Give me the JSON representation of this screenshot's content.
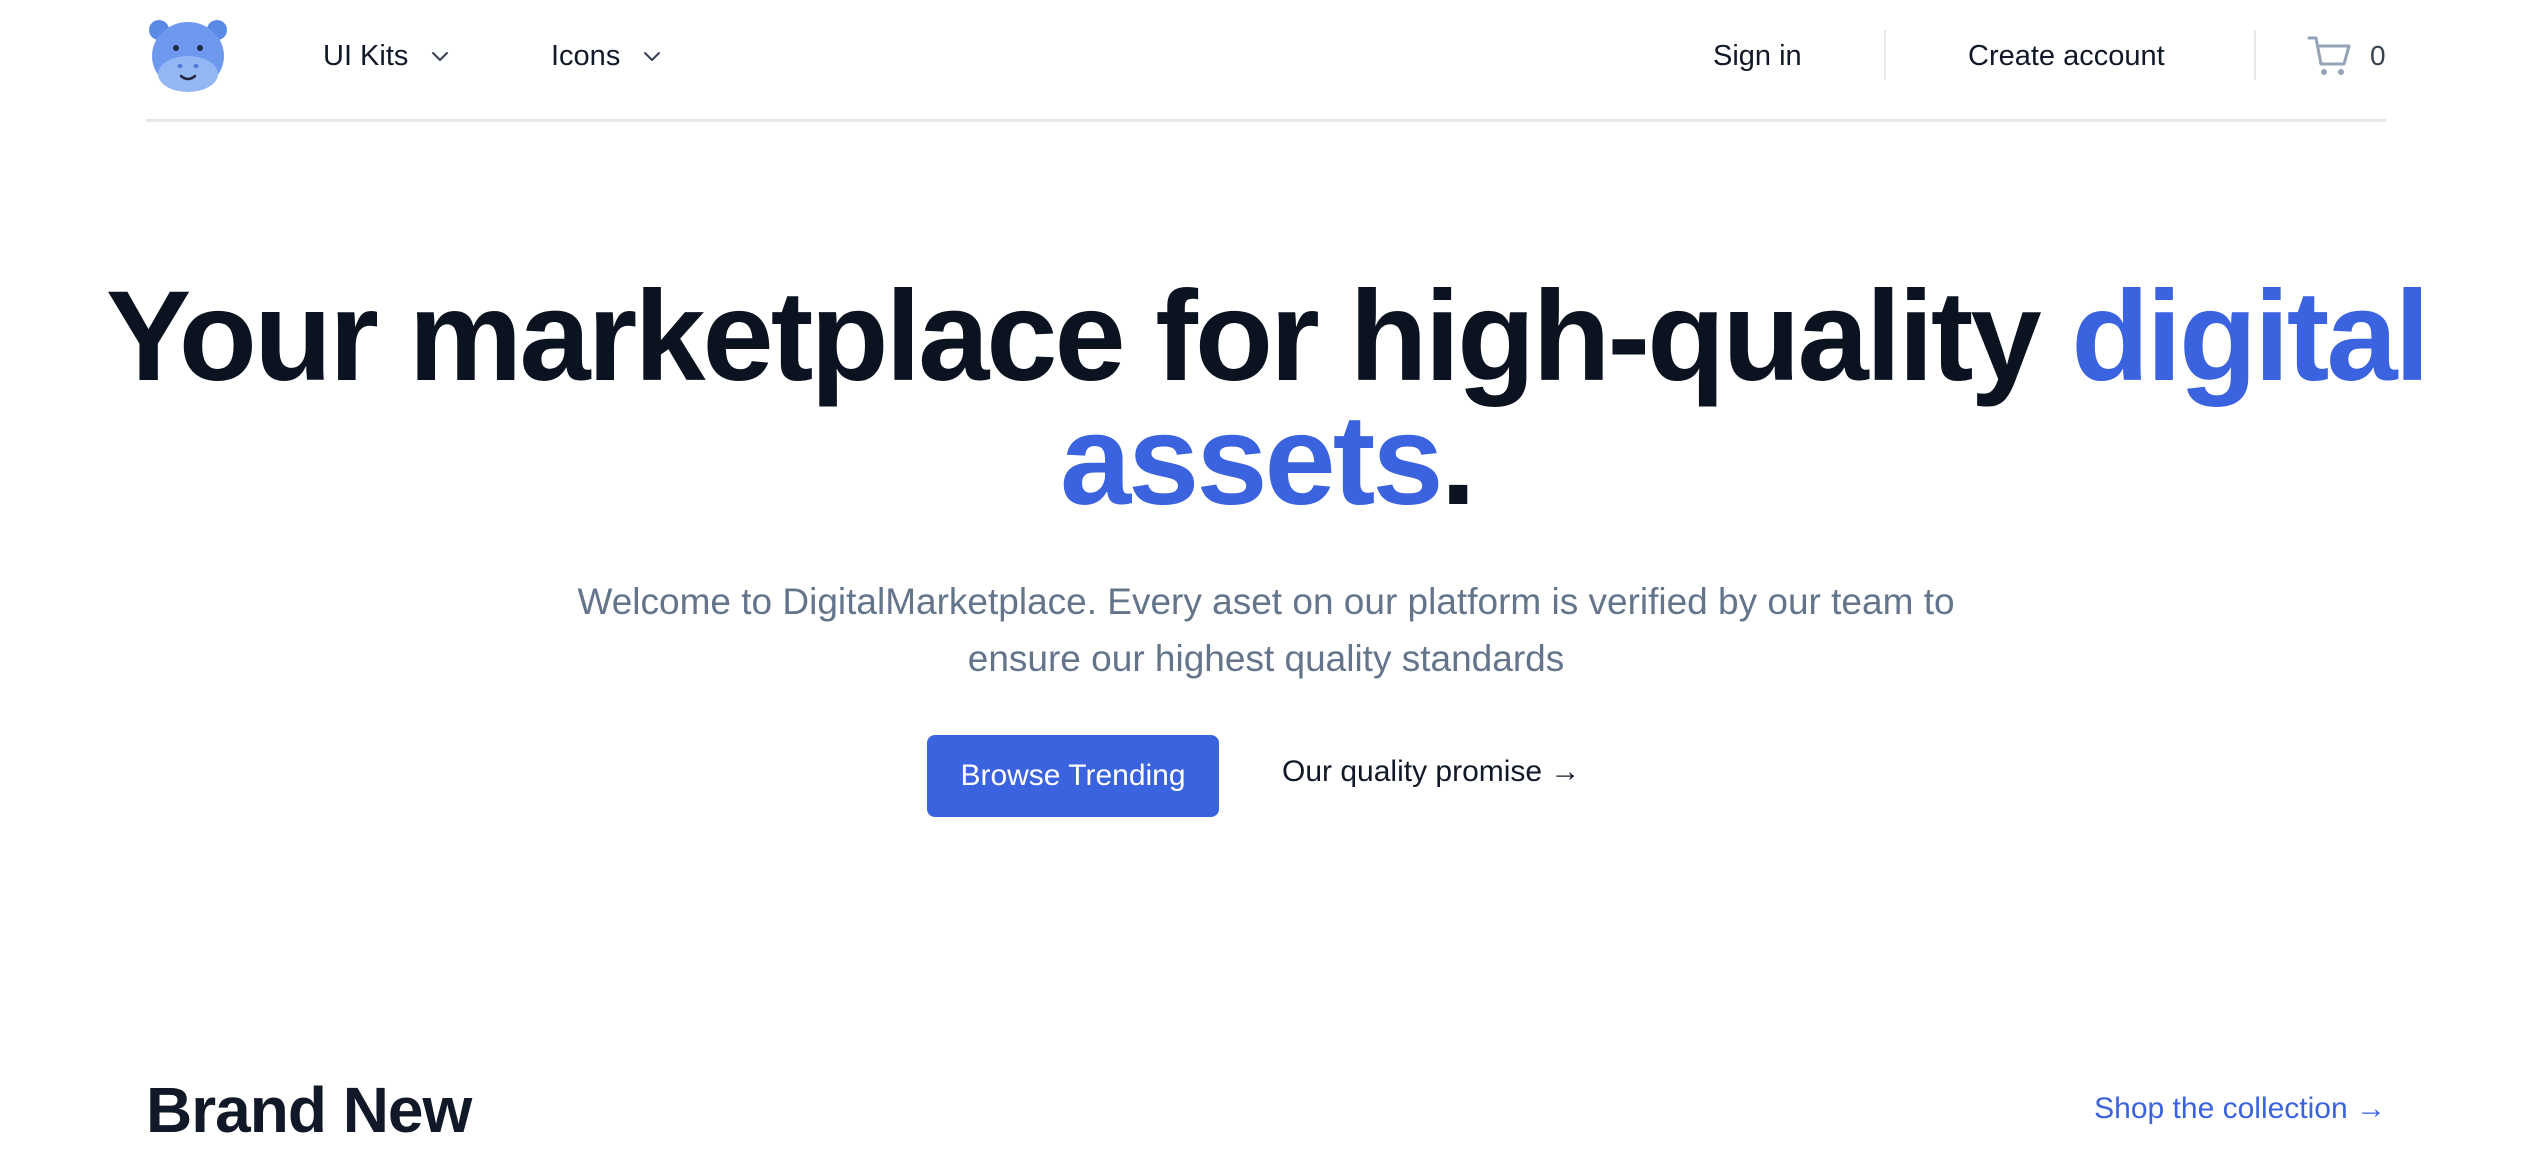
{
  "header": {
    "logo_name": "hippo-logo",
    "nav": [
      {
        "label": "UI Kits",
        "icon": "chevron-down-icon"
      },
      {
        "label": "Icons",
        "icon": "chevron-down-icon"
      }
    ],
    "sign_in": "Sign in",
    "create_account": "Create account",
    "cart_count": "0"
  },
  "hero": {
    "title_part1": "Your marketplace for high-quality",
    "title_highlight": "digital assets",
    "title_end": ".",
    "subtitle": "Welcome to DigitalMarketplace. Every aset on our platform is verified by our team to ensure our highest quality standards",
    "primary_button": "Browse Trending",
    "secondary_link": "Our quality promise →"
  },
  "section": {
    "title": "Brand New",
    "link": "Shop the collection →"
  },
  "colors": {
    "accent": "#3b63e0",
    "text": "#0b1220",
    "muted": "#64748b",
    "border": "#e5e7eb"
  }
}
